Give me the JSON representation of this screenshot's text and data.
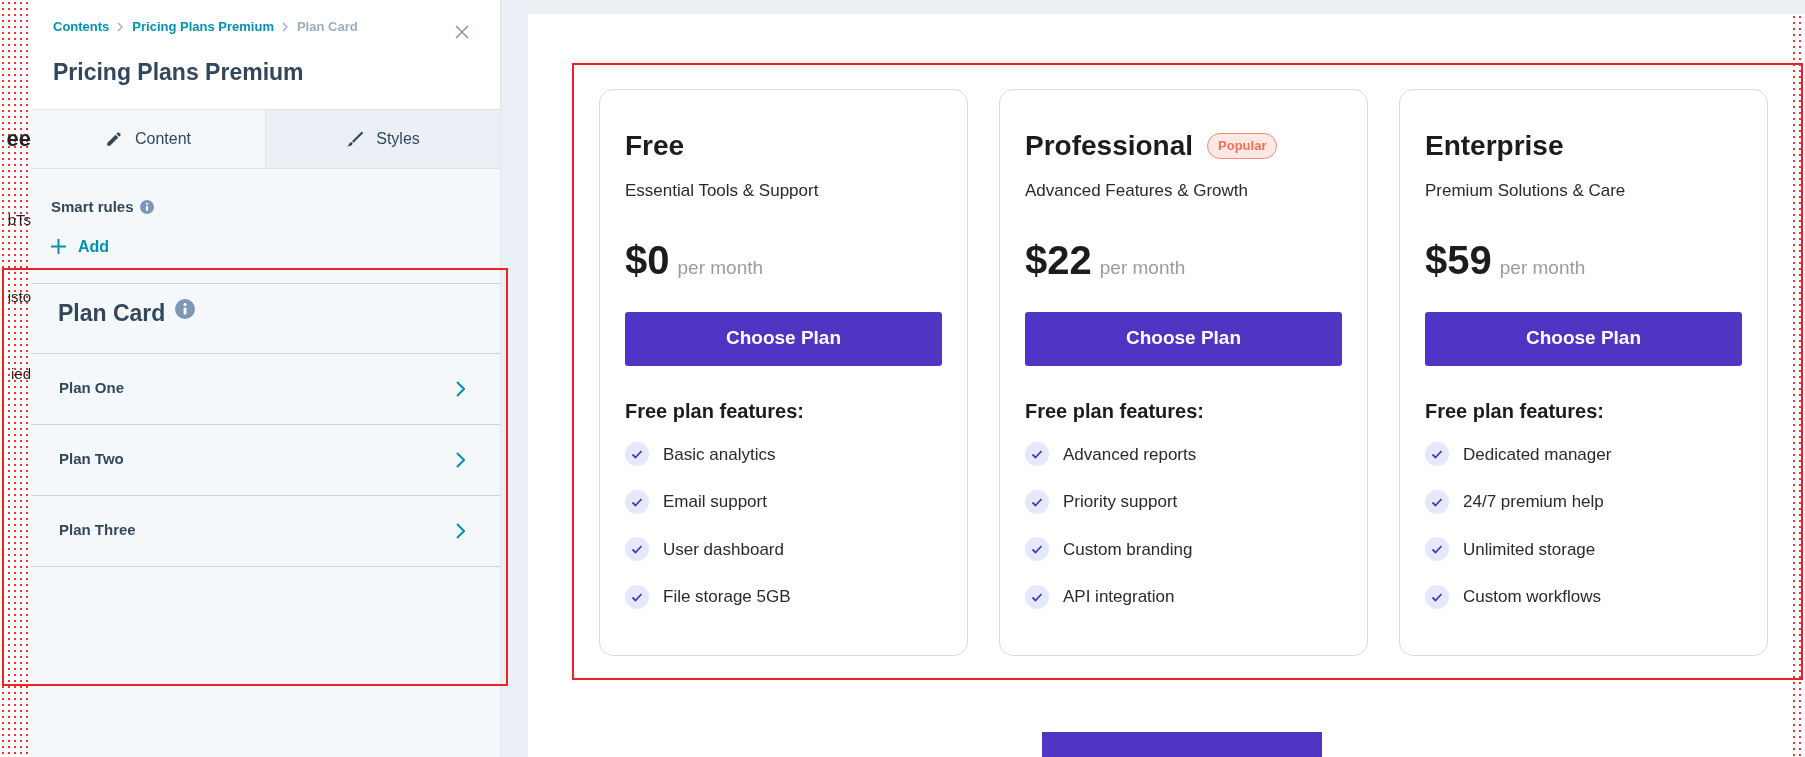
{
  "background_fragments": [
    "ee",
    "bTs",
    "isto",
    "ied"
  ],
  "panel": {
    "breadcrumb": [
      {
        "label": "Contents",
        "current": false
      },
      {
        "label": "Pricing Plans Premium",
        "current": false
      },
      {
        "label": "Plan Card",
        "current": true
      }
    ],
    "title": "Pricing Plans Premium",
    "tabs": [
      {
        "label": "Content",
        "selected": true
      },
      {
        "label": "Styles",
        "selected": false
      }
    ],
    "smart_rules": {
      "label": "Smart rules",
      "add": "Add"
    },
    "section": {
      "title": "Plan Card",
      "items": [
        "Plan One",
        "Plan Two",
        "Plan Three"
      ]
    }
  },
  "plans": [
    {
      "name": "Free",
      "subtitle": "Essential Tools & Support",
      "price": "$0",
      "period": "per month",
      "button": "Choose Plan",
      "features_title": "Free plan features:",
      "features": [
        "Basic analytics",
        "Email support",
        "User dashboard",
        "File storage 5GB"
      ]
    },
    {
      "name": "Professional",
      "badge": "Popular",
      "subtitle": "Advanced Features & Growth",
      "price": "$22",
      "period": "per month",
      "button": "Choose Plan",
      "features_title": "Free plan features:",
      "features": [
        "Advanced reports",
        "Priority support",
        "Custom branding",
        "API integration"
      ]
    },
    {
      "name": "Enterprise",
      "subtitle": "Premium Solutions & Care",
      "price": "$59",
      "period": "per month",
      "button": "Choose Plan",
      "features_title": "Free plan features:",
      "features": [
        "Dedicated manager",
        "24/7 premium help",
        "Unlimited storage",
        "Custom workflows"
      ]
    }
  ]
}
